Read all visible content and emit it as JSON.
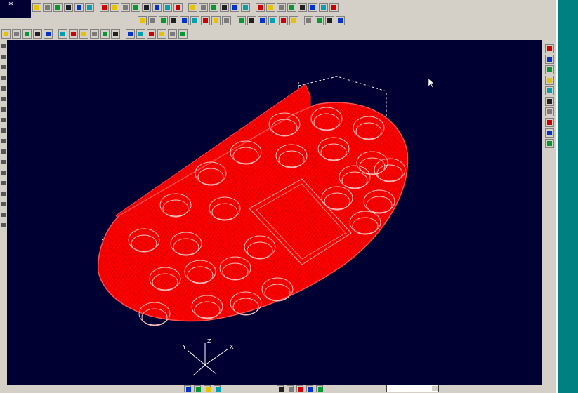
{
  "colors": {
    "viewport_background": "#000033",
    "model_wireframe": "#ff0000",
    "construction_lines": "#ffffff",
    "toolbar_face": "#d4d0c8",
    "right_edge": "#008080"
  },
  "icons": {
    "toolbar_row_1": [
      "new-icon",
      "open-icon",
      "save-icon",
      "print-icon",
      "list-icon",
      "play-icon",
      "zoom-in-icon",
      "zoom-out-icon",
      "pan-icon",
      "rotate-icon",
      "fit-icon",
      "layer-icon",
      "view-icon",
      "window-icon",
      "cube-icon",
      "cube-icon",
      "cube-icon",
      "render-icon",
      "shade-icon",
      "grid-icon",
      "snap-icon",
      "check-icon",
      "tool-icon",
      "tool-icon",
      "tool-icon",
      "tool-icon",
      "tool-icon",
      "tool-icon"
    ],
    "toolbar_row_2": [
      "line-icon",
      "arc-icon",
      "circle-icon",
      "box-icon",
      "cylinder-icon",
      "solid-icon",
      "surface-icon",
      "mesh-icon",
      "fillet-icon",
      "chamfer-icon",
      "extrude-icon",
      "revolve-icon",
      "sweep-icon",
      "loft-icon",
      "shell-icon",
      "pocket-icon",
      "drill-icon",
      "sheet-icon",
      "3d-icon"
    ],
    "toolbar_row_3": [
      "select-icon",
      "point-icon",
      "line-icon",
      "spline-icon",
      "trim-icon",
      "extend-icon",
      "offset-icon",
      "mirror-icon",
      "copy-icon",
      "move-icon",
      "scale-icon",
      "array-icon",
      "dimension-icon",
      "text-icon",
      "hatch-icon",
      "measure-icon",
      "delete-icon"
    ],
    "right_panel": [
      "zoom-icon",
      "shade-icon",
      "view-icon",
      "layer-icon",
      "light-icon",
      "render-icon",
      "camera-icon",
      "color-icon",
      "grid-icon",
      "text-size-icon"
    ],
    "status": [
      "status-icon",
      "status-icon",
      "status-icon",
      "status-icon",
      "status-icon",
      "status-icon",
      "status-icon",
      "status-icon",
      "close-icon"
    ]
  },
  "axis_triad": {
    "x_label": "X",
    "y_label": "Y",
    "z_label": "Z"
  }
}
